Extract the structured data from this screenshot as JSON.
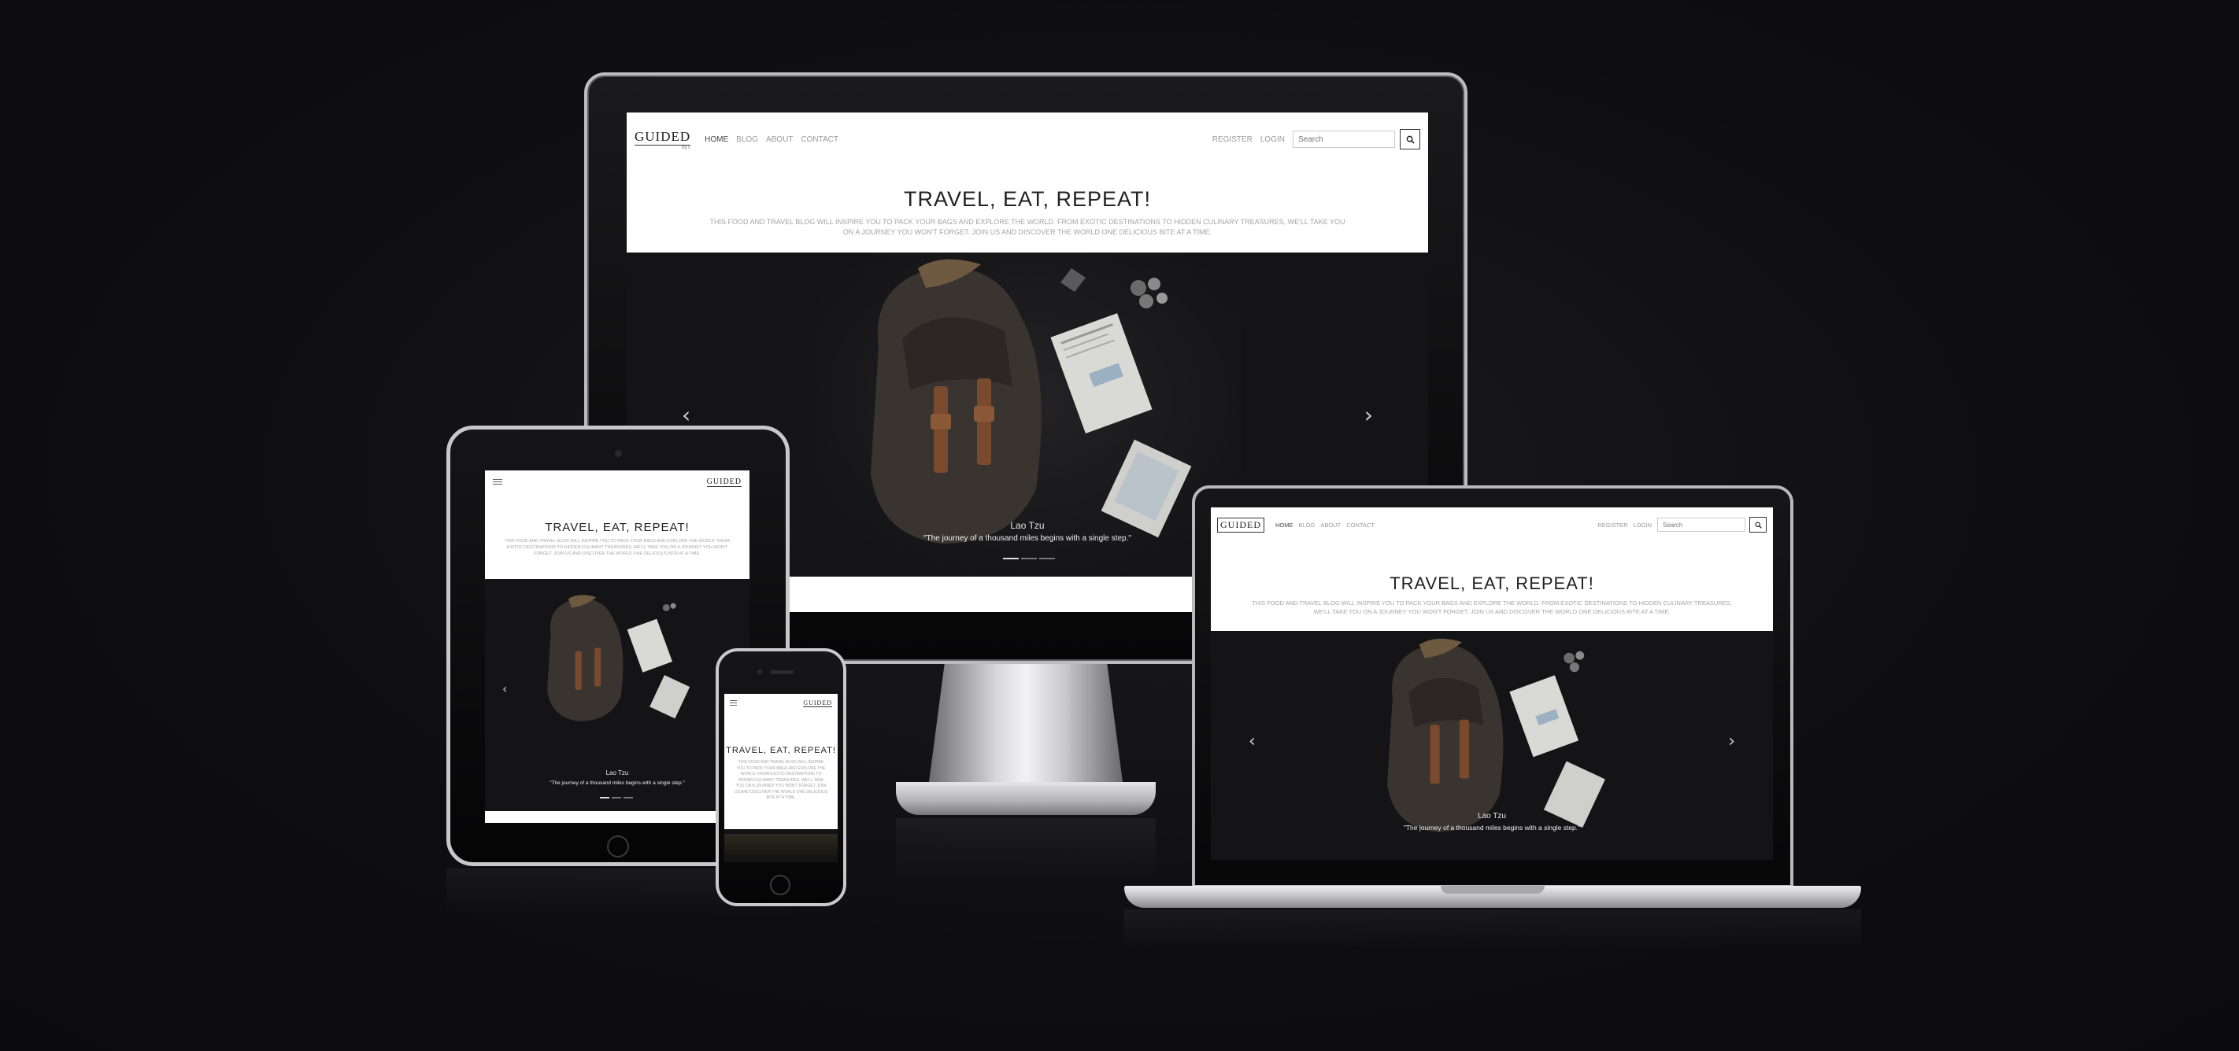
{
  "site": {
    "logo": "GUIDED",
    "logo_tagline": "by c",
    "nav_links": [
      "HOME",
      "BLOG",
      "ABOUT",
      "CONTACT"
    ],
    "auth_links": [
      "REGISTER",
      "LOGIN"
    ],
    "search_placeholder": "Search",
    "hero_title": "TRAVEL, EAT, REPEAT!",
    "hero_description": "THIS FOOD AND TRAVEL BLOG WILL INSPIRE YOU TO PACK YOUR BAGS AND EXPLORE THE WORLD. FROM EXOTIC DESTINATIONS TO HIDDEN CULINARY TREASURES, WE'LL TAKE YOU ON A JOURNEY YOU WON'T FORGET. JOIN US AND DISCOVER THE WORLD ONE DELICIOUS BITE AT A TIME.",
    "carousel": {
      "author": "Lao Tzu",
      "quote": "\"The journey of a thousand miles begins with a single step.\"",
      "prev_glyph": "‹",
      "next_glyph": "›",
      "slides": 3,
      "active_slide": 1
    }
  },
  "icons": {
    "search": "search-icon",
    "menu": "hamburger-menu-icon",
    "prev": "chevron-left-icon",
    "next": "chevron-right-icon"
  },
  "colors": {
    "background": "#0e0e10",
    "screen": "#ffffff",
    "carousel_bg": "#141416",
    "accent_text": "#222222",
    "muted_text": "#a4a4a4",
    "bag_leather": "#7a4a2e",
    "bag_canvas": "#3a3430"
  }
}
